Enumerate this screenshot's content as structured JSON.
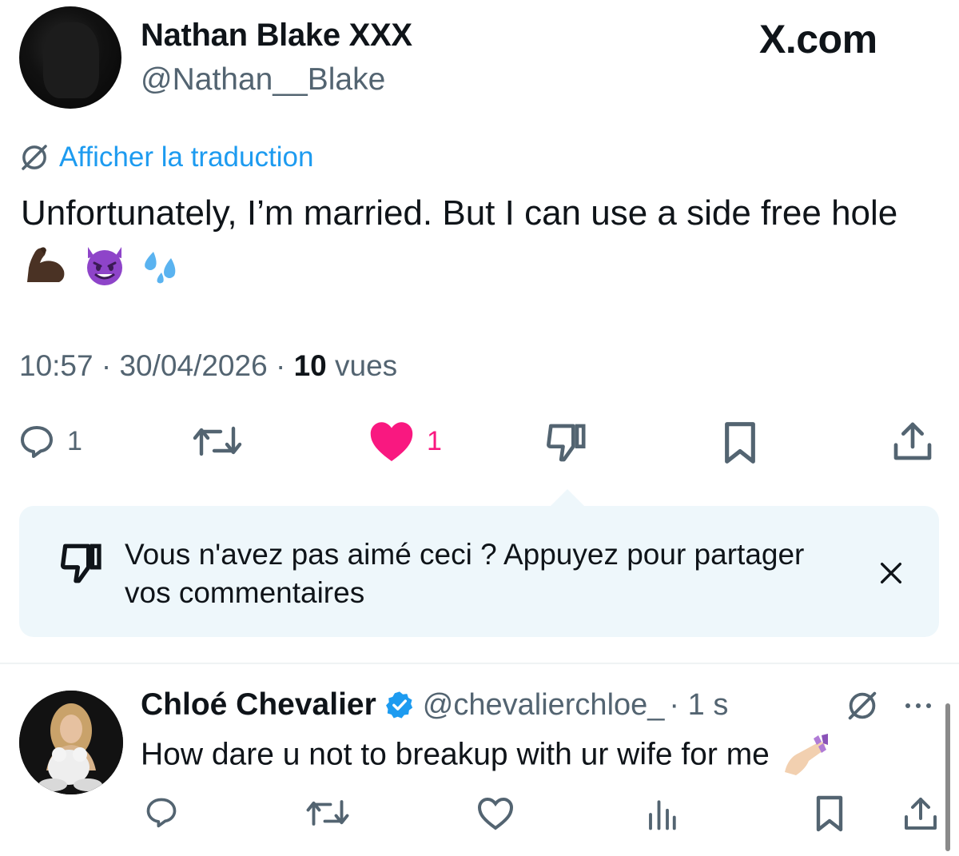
{
  "header": {
    "author_name": "Nathan Blake XXX",
    "author_handle": "@Nathan__Blake",
    "brand": "X.com"
  },
  "tweet": {
    "translate_label": "Afficher la traduction",
    "text": "Unfortunately, I’m married. But I can use a side free hole",
    "emojis": [
      "flexed-biceps-dark",
      "smiling-imp",
      "sweat-droplets"
    ],
    "time": "10:57",
    "date": "30/04/2026",
    "views_count": "10",
    "views_label": "vues",
    "separator": "·"
  },
  "actions": {
    "reply_count": "1",
    "like_count": "1"
  },
  "feedback": {
    "text": "Vous n'avez pas aimé ceci ? Appuyez pour partager vos commentaires"
  },
  "reply": {
    "name": "Chloé Chevalier",
    "handle": "@chevalierchloe_",
    "time": "· 1 s",
    "text": "How dare u not to breakup with ur wife for me"
  },
  "colors": {
    "accent": "#1d9bf0",
    "like": "#f91880",
    "muted": "#536471",
    "feedback_bg": "#eef7fb"
  }
}
